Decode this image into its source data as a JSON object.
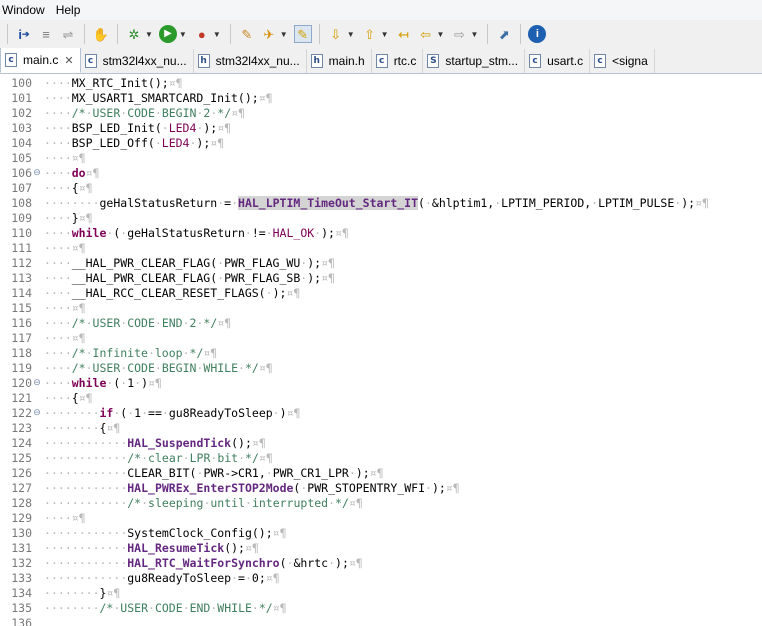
{
  "menubar": {
    "items": [
      "Window",
      "Help"
    ]
  },
  "toolbar": {
    "icons": [
      "step-into-icon",
      "step-over-icon",
      "step-return-icon",
      "debug-perspective-icon",
      "build-icon",
      "run-icon",
      "external-tools-icon",
      "open-task-icon",
      "launch-icon",
      "toggle-mark-icon",
      "next-annotation-icon",
      "prev-annotation-icon",
      "last-edit-icon",
      "back-icon",
      "forward-icon",
      "pin-editor-icon",
      "info-icon"
    ]
  },
  "tabs": [
    {
      "label": "main.c",
      "type": "c",
      "active": true
    },
    {
      "label": "stm32l4xx_nu...",
      "type": "c",
      "active": false
    },
    {
      "label": "stm32l4xx_nu...",
      "type": "h",
      "active": false
    },
    {
      "label": "main.h",
      "type": "h",
      "active": false
    },
    {
      "label": "rtc.c",
      "type": "c",
      "active": false
    },
    {
      "label": "startup_stm...",
      "type": "s",
      "active": false
    },
    {
      "label": "usart.c",
      "type": "c",
      "active": false
    },
    {
      "label": "<signa",
      "type": "c",
      "active": false
    }
  ],
  "editor": {
    "lines": [
      {
        "n": "100",
        "fold": "",
        "html": "····MX_RTC_Init();¤¶"
      },
      {
        "n": "101",
        "fold": "",
        "html": "····MX_USART1_SMARTCARD_Init();¤¶"
      },
      {
        "n": "102",
        "fold": "",
        "html": "····/*·USER·CODE·BEGIN·2·*/¤¶"
      },
      {
        "n": "103",
        "fold": "",
        "html": "····BSP_LED_Init(·LED4·);¤¶"
      },
      {
        "n": "104",
        "fold": "",
        "html": "····BSP_LED_Off(·LED4·);¤¶"
      },
      {
        "n": "105",
        "fold": "",
        "html": "····¤¶"
      },
      {
        "n": "106",
        "fold": "⊖",
        "html": "····do¤¶"
      },
      {
        "n": "107",
        "fold": "",
        "html": "····{¤¶"
      },
      {
        "n": "108",
        "fold": "",
        "html": "········geHalStatusReturn·=·HAL_LPTIM_TimeOut_Start_IT(·&hlptim1,·LPTIM_PERIOD,·LPTIM_PULSE·);¤¶"
      },
      {
        "n": "109",
        "fold": "",
        "html": "····}¤¶"
      },
      {
        "n": "110",
        "fold": "",
        "html": "····while·(·geHalStatusReturn·!=·HAL_OK·);¤¶"
      },
      {
        "n": "111",
        "fold": "",
        "html": "····¤¶"
      },
      {
        "n": "112",
        "fold": "",
        "html": "····__HAL_PWR_CLEAR_FLAG(·PWR_FLAG_WU·);¤¶"
      },
      {
        "n": "113",
        "fold": "",
        "html": "····__HAL_PWR_CLEAR_FLAG(·PWR_FLAG_SB·);¤¶"
      },
      {
        "n": "114",
        "fold": "",
        "html": "····__HAL_RCC_CLEAR_RESET_FLAGS(·);¤¶"
      },
      {
        "n": "115",
        "fold": "",
        "html": "····¤¶"
      },
      {
        "n": "116",
        "fold": "",
        "html": "····/*·USER·CODE·END·2·*/¤¶"
      },
      {
        "n": "117",
        "fold": "",
        "html": "····¤¶"
      },
      {
        "n": "118",
        "fold": "",
        "html": "····/*·Infinite·loop·*/¤¶"
      },
      {
        "n": "119",
        "fold": "",
        "html": "····/*·USER·CODE·BEGIN·WHILE·*/¤¶"
      },
      {
        "n": "120",
        "fold": "⊖",
        "html": "····while·(·1·)¤¶"
      },
      {
        "n": "121",
        "fold": "",
        "html": "····{¤¶"
      },
      {
        "n": "122",
        "fold": "⊖",
        "html": "········if·(·1·==·gu8ReadyToSleep·)¤¶"
      },
      {
        "n": "123",
        "fold": "",
        "html": "········{¤¶"
      },
      {
        "n": "124",
        "fold": "",
        "html": "············HAL_SuspendTick();¤¶"
      },
      {
        "n": "125",
        "fold": "",
        "html": "············/*·clear·LPR·bit·*/¤¶"
      },
      {
        "n": "126",
        "fold": "",
        "html": "············CLEAR_BIT(·PWR->CR1,·PWR_CR1_LPR·);¤¶"
      },
      {
        "n": "127",
        "fold": "",
        "html": "············HAL_PWREx_EnterSTOP2Mode(·PWR_STOPENTRY_WFI·);¤¶"
      },
      {
        "n": "128",
        "fold": "",
        "html": "············/*·sleeping·until·interrupted·*/¤¶"
      },
      {
        "n": "129",
        "fold": "",
        "html": "····¤¶"
      },
      {
        "n": "130",
        "fold": "",
        "html": "············SystemClock_Config();¤¶"
      },
      {
        "n": "131",
        "fold": "",
        "html": "············HAL_ResumeTick();¤¶"
      },
      {
        "n": "132",
        "fold": "",
        "html": "············HAL_RTC_WaitForSynchro(·&hrtc·);¤¶"
      },
      {
        "n": "133",
        "fold": "",
        "html": "············gu8ReadyToSleep·=·0;¤¶"
      },
      {
        "n": "134",
        "fold": "",
        "html": "········}¤¶"
      },
      {
        "n": "135",
        "fold": "",
        "html": "········/*·USER·CODE·END·WHILE·*/¤¶"
      },
      {
        "n": "136",
        "fold": "",
        "html": ""
      }
    ]
  },
  "colors": {
    "keyword": "#7f0055",
    "comment": "#3f7f5f",
    "function": "#642880",
    "whitespace": "#b8b8b8",
    "highlight": "#d4d4d4"
  }
}
